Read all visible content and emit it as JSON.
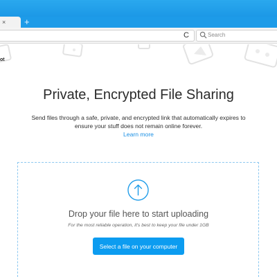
{
  "browser": {
    "tab_close_glyph": "×",
    "new_tab_glyph": "+",
    "reload_glyph": "C",
    "search_placeholder": "Search"
  },
  "page": {
    "logo_fragment": "ot",
    "headline": "Private, Encrypted File Sharing",
    "description": "Send files through a safe, private, and encrypted link that automatically expires to ensure your stuff does not remain online forever.",
    "learn_more": "Learn more",
    "drop_title": "Drop your file here to start uploading",
    "drop_hint": "For the most reliable operation, it's best to keep your file under 1GB",
    "select_button": "Select a file on your computer"
  },
  "colors": {
    "title_bar": "#1c98e6",
    "accent": "#0c9cf0",
    "link": "#1a8fe4",
    "dropzone_border": "#8cc8f0"
  },
  "icons": {
    "upload": "upload-arrow-icon",
    "search": "search-icon",
    "reload": "reload-icon"
  }
}
